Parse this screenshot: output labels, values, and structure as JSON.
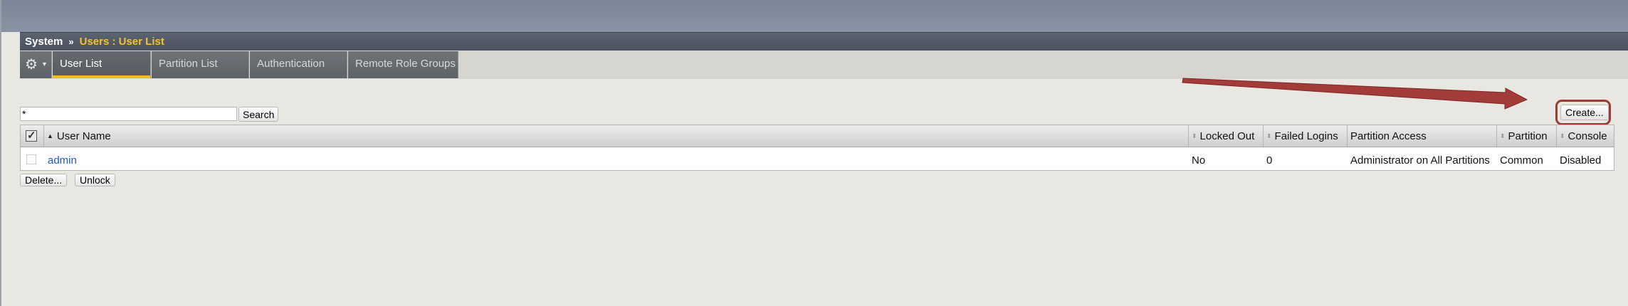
{
  "breadcrumb": {
    "system": "System",
    "separator": "»",
    "current": "Users : User List"
  },
  "tabs": [
    {
      "label": "User List",
      "active": true
    },
    {
      "label": "Partition List",
      "active": false
    },
    {
      "label": "Authentication",
      "active": false
    },
    {
      "label": "Remote Role Groups",
      "active": false
    }
  ],
  "search": {
    "value": "*",
    "button_label": "Search"
  },
  "toolbar": {
    "create_label": "Create..."
  },
  "table": {
    "columns": [
      "User Name",
      "Locked Out",
      "Failed Logins",
      "Partition Access",
      "Partition",
      "Console"
    ],
    "rows": [
      {
        "user_name": "admin",
        "locked_out": "No",
        "failed_logins": "0",
        "partition_access": "Administrator on All Partitions",
        "partition": "Common",
        "console": "Disabled"
      }
    ]
  },
  "actions": {
    "delete_label": "Delete...",
    "unlock_label": "Unlock"
  },
  "colors": {
    "accent": "#f0bd1e",
    "annotation": "#a33b38",
    "link": "#1f56c4"
  }
}
